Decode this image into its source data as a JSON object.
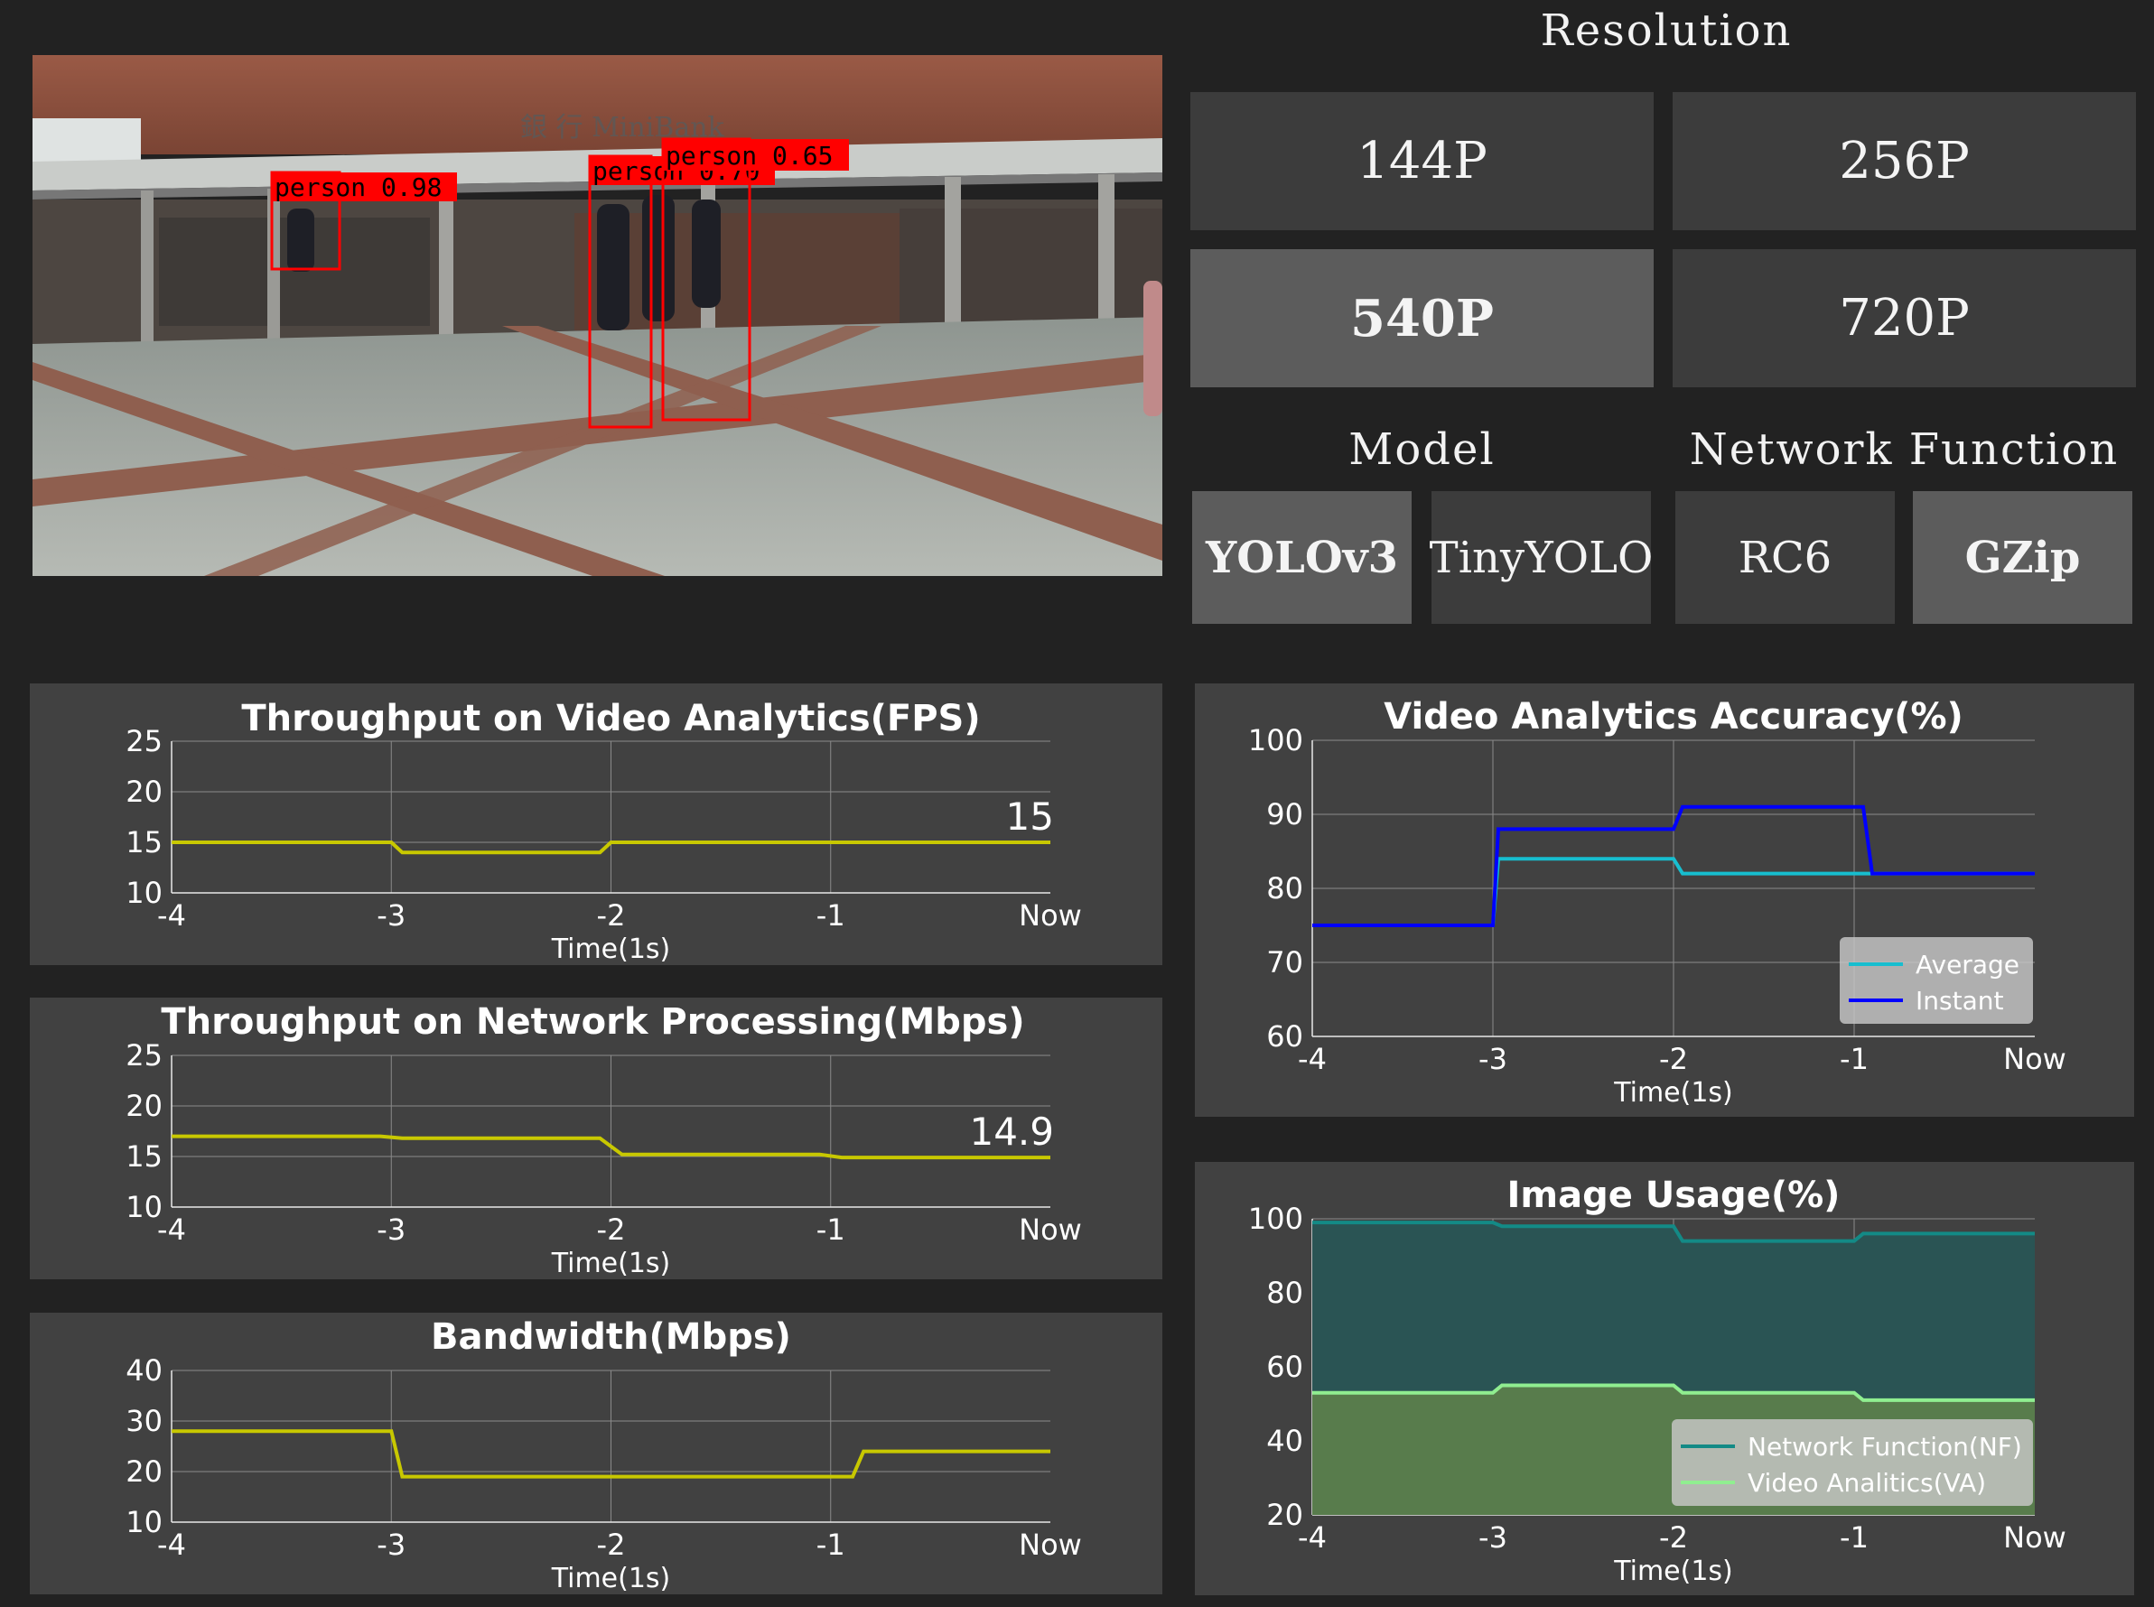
{
  "video": {
    "bank_sign": "銀 行 MiniBank",
    "detections": [
      {
        "label": "person 0.98"
      },
      {
        "label": "person 0.70"
      },
      {
        "label": "person 0.65"
      }
    ]
  },
  "controls": {
    "resolution_title": "Resolution",
    "resolutions": [
      {
        "label": "144P",
        "selected": false
      },
      {
        "label": "256P",
        "selected": false
      },
      {
        "label": "540P",
        "selected": true
      },
      {
        "label": "720P",
        "selected": false
      }
    ],
    "model_title": "Model",
    "models": [
      {
        "label": "YOLOv3",
        "selected": true
      },
      {
        "label": "TinyYOLO",
        "selected": false
      }
    ],
    "network_function_title": "Network Function",
    "network_functions": [
      {
        "label": "RC6",
        "selected": false
      },
      {
        "label": "GZip",
        "selected": true
      }
    ]
  },
  "colors": {
    "background": "#222222",
    "panel": "#414141",
    "button": "#3c3c3c",
    "button_selected": "#5c5c5c",
    "yellow_line": "#c8c800",
    "average": "#17becf",
    "instant": "#0000ff",
    "nf_line": "#138a86",
    "nf_fill": "#2a5454",
    "va_line": "#90ee90",
    "va_fill": "#587c4c"
  },
  "chart_data": [
    {
      "id": "fps",
      "type": "line",
      "title": "Throughput on Video Analytics(FPS)",
      "xlabel": "Time(1s)",
      "xticks": [
        "-4",
        "-3",
        "-2",
        "-1",
        "Now"
      ],
      "ylim": [
        10,
        25
      ],
      "yticks": [
        "10",
        "15",
        "20",
        "25"
      ],
      "grid": true,
      "current_value": "15",
      "series": [
        {
          "x": [
            -4,
            -3.0,
            -2.95,
            -2.05,
            -2.0,
            0
          ],
          "values": [
            15,
            15,
            14,
            14,
            15,
            15
          ],
          "color": "#c8c800"
        }
      ]
    },
    {
      "id": "np",
      "type": "line",
      "title": "Throughput on Network Processing(Mbps)",
      "xlabel": "Time(1s)",
      "xticks": [
        "-4",
        "-3",
        "-2",
        "-1",
        "Now"
      ],
      "ylim": [
        10,
        25
      ],
      "yticks": [
        "10",
        "15",
        "20",
        "25"
      ],
      "grid": true,
      "current_value": "14.9",
      "series": [
        {
          "x": [
            -4,
            -3.05,
            -2.95,
            -2.05,
            -1.95,
            -1.05,
            -0.95,
            0
          ],
          "values": [
            17,
            17,
            16.8,
            16.8,
            15.2,
            15.2,
            14.9,
            14.9
          ],
          "color": "#c8c800"
        }
      ]
    },
    {
      "id": "bw",
      "type": "line",
      "title": "Bandwidth(Mbps)",
      "xlabel": "Time(1s)",
      "xticks": [
        "-4",
        "-3",
        "-2",
        "-1",
        "Now"
      ],
      "ylim": [
        10,
        40
      ],
      "yticks": [
        "10",
        "20",
        "30",
        "40"
      ],
      "grid": true,
      "series": [
        {
          "x": [
            -4,
            -3.0,
            -2.95,
            -0.9,
            -0.85,
            0
          ],
          "values": [
            28,
            28,
            19,
            19,
            24,
            24
          ],
          "color": "#c8c800"
        }
      ]
    },
    {
      "id": "acc",
      "type": "line",
      "title": "Video Analytics Accuracy(%)",
      "xlabel": "Time(1s)",
      "xticks": [
        "-4",
        "-3",
        "-2",
        "-1",
        "Now"
      ],
      "ylim": [
        60,
        100
      ],
      "yticks": [
        "60",
        "70",
        "80",
        "90",
        "100"
      ],
      "grid": true,
      "legend_position": "lower-right",
      "series": [
        {
          "name": "Average",
          "color": "#17becf",
          "x": [
            -4,
            -3.0,
            -2.97,
            -2.0,
            -1.95,
            -0.95,
            -0.92,
            0
          ],
          "values": [
            75,
            75,
            84,
            84,
            82,
            82,
            82,
            82
          ]
        },
        {
          "name": "Instant",
          "color": "#0000ff",
          "x": [
            -4,
            -3.0,
            -2.97,
            -2.0,
            -1.95,
            -0.95,
            -0.9,
            0
          ],
          "values": [
            75,
            75,
            88,
            88,
            91,
            91,
            82,
            82
          ]
        }
      ]
    },
    {
      "id": "usage",
      "type": "area",
      "title": "Image Usage(%)",
      "xlabel": "Time(1s)",
      "xticks": [
        "-4",
        "-3",
        "-2",
        "-1",
        "Now"
      ],
      "ylim": [
        20,
        100
      ],
      "yticks": [
        "20",
        "40",
        "60",
        "80",
        "100"
      ],
      "grid": true,
      "legend_position": "lower-right",
      "series": [
        {
          "name": "Network Function(NF)",
          "color": "#138a86",
          "fill": "#2a5454",
          "x": [
            -4,
            -3.0,
            -2.95,
            -2.0,
            -1.95,
            -1.0,
            -0.95,
            0
          ],
          "values": [
            99,
            99,
            98,
            98,
            94,
            94,
            96,
            96
          ]
        },
        {
          "name": "Video Analitics(VA)",
          "color": "#90ee90",
          "fill": "#587c4c",
          "x": [
            -4,
            -3.0,
            -2.95,
            -2.0,
            -1.95,
            -1.0,
            -0.95,
            0
          ],
          "values": [
            53,
            53,
            55,
            55,
            53,
            53,
            51,
            51
          ]
        }
      ]
    }
  ]
}
